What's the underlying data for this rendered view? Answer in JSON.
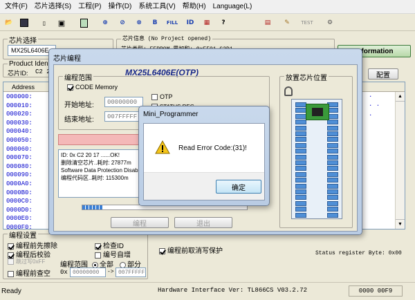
{
  "menu": [
    "文件(F)",
    "芯片选择(S)",
    "工程(P)",
    "操作(D)",
    "系统工具(V)",
    "帮助(H)",
    "Language(L)"
  ],
  "toolbar_icons": [
    "open-icon",
    "save-icon",
    "program-icon",
    "load-icon",
    "device-icon",
    "read-icon",
    "verify-icon",
    "blank-check-icon",
    "erase-icon",
    "fill-icon",
    "read-id-icon",
    "lock-icon",
    "help-icon",
    "program-config-icon",
    "edit-icon",
    "test-icon",
    "settings-icon"
  ],
  "toolbar_labels": {
    "fill": "FILL",
    "test": "TEST"
  },
  "chip_select": {
    "title": "芯片选择",
    "value": "MX25L6406E"
  },
  "product": {
    "title": "Product Iden",
    "chip_id_label": "芯片ID:",
    "chip_id_value": "C2 2"
  },
  "chip_info": {
    "title": "芯片信息 (No Project opened)",
    "type_line": "芯片类型:  EEPROM   累加和: 0xFF91 C2D1"
  },
  "info_button": "Information",
  "config_button": "配置",
  "hex": {
    "header": "Address",
    "addresses": [
      "000000:",
      "000010:",
      "000020:",
      "000030:",
      "000040:",
      "000050:",
      "000060:",
      "000070:",
      "000080:",
      "000090:",
      "0000A0:",
      "0000B0:",
      "0000C0:",
      "0000D0:",
      "0000E0:",
      "0000F0:"
    ],
    "right_marks": [
      "·",
      "· ·",
      ".",
      "",
      "",
      "",
      "",
      "",
      "",
      "",
      "",
      "",
      "",
      "",
      "",
      ""
    ]
  },
  "prog_settings": {
    "title": "编程设置",
    "erase_before": "编程前先擦除",
    "verify_after": "编程后校验",
    "skip_ff": "跳过写0xFF",
    "check_blank": "编程前查空",
    "check_id": "检查ID",
    "auto_inc": "编号自增",
    "range_label": "编程范围",
    "range_all": "全部",
    "range_part": "部分",
    "range_from": "0x",
    "range_start": "00000000",
    "range_end": "007FFFFF",
    "arrow": "->"
  },
  "protect_label": "编程前取消写保护",
  "status_register": "Status register Byte: 0x00",
  "statusbar": {
    "ready": "Ready",
    "hw_ver": "Hardware Interface Ver: TL866CS V03.2.72",
    "addr": "0000 00F9"
  },
  "chip_dialog": {
    "title": "芯片编程",
    "chip_name": "MX25L6406E(OTP)",
    "range_group": "编程范围",
    "code_memory": "CODE Memory",
    "start_label": "开始地址:",
    "start_value": "00000000",
    "end_label": "结束地址:",
    "end_value": "007FFFFF",
    "otp": "OTP",
    "status_reg": "STATUS REG",
    "red_bar_text": "正",
    "log": [
      "ID: 0x C2 20 17 ......OK!",
      "删除清空芯片..耗时: 27877m",
      "Software Data Protection Disab",
      "编程代码区..耗时: 115300m"
    ],
    "progress": 0.12,
    "btn_program": "编程",
    "btn_exit": "退出",
    "position_title": "放置芯片位置"
  },
  "error_dialog": {
    "title": "Mini_Programmer",
    "message": "Read Error Code:(31)!",
    "ok": "确定"
  },
  "colors": {
    "accent_blue": "#0000cc",
    "red_bar": "#f4b8b8",
    "progress": "#3a7fd5",
    "chip_title": "#1a2a8a",
    "socket_green": "#3a9a3a"
  }
}
